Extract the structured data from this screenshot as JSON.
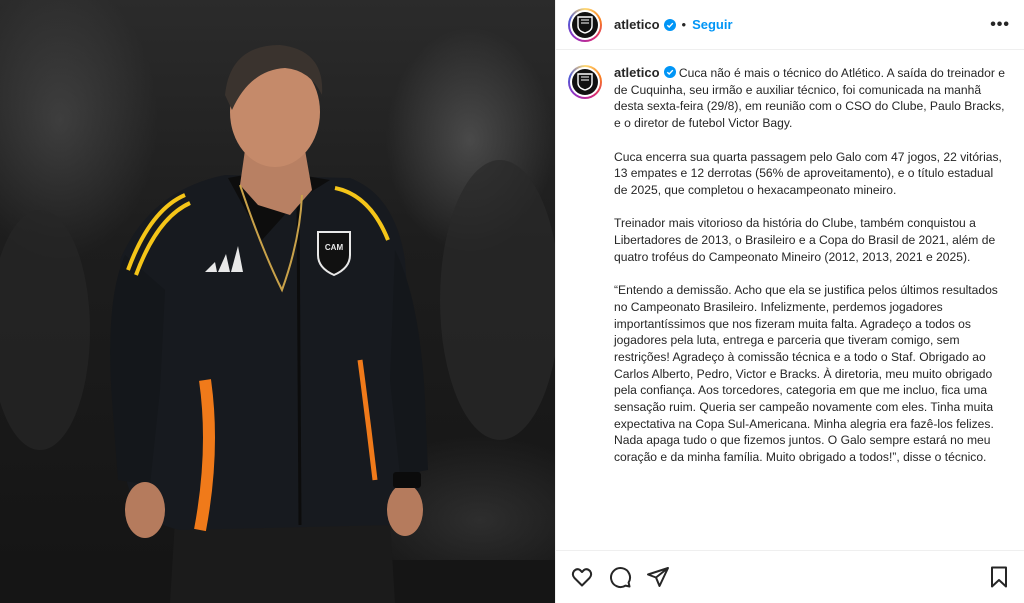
{
  "post": {
    "username": "atletico",
    "separator": "•",
    "follow_label": "Seguir",
    "more_label": "•••",
    "caption_username": "atletico",
    "paragraphs": [
      "Cuca não é mais o técnico do Atlético. A saída do treinador e de Cuquinha, seu irmão e auxiliar técnico, foi comunicada na manhã desta sexta-feira (29/8), em reunião com o CSO do Clube, Paulo Bracks, e o diretor de futebol Victor Bagy.",
      "Cuca encerra sua quarta passagem pelo Galo com 47 jogos, 22 vitórias, 13 empates e 12 derrotas (56% de aproveitamento), e o título estadual de 2025, que completou o hexacampeonato mineiro.",
      "Treinador mais vitorioso da história do Clube, também conquistou a Libertadores de 2013, o Brasileiro e a Copa do Brasil de 2021, além de quatro troféus do Campeonato Mineiro (2012, 2013, 2021 e 2025).",
      "“Entendo a demissão. Acho que ela se justifica pelos últimos resultados no Campeonato Brasileiro. Infelizmente, perdemos jogadores importantíssimos que nos fizeram muita falta. Agradeço a todos os jogadores pela luta, entrega e parceria que tiveram comigo, sem restrições! Agradeço à comissão técnica e a todo o Staf. Obrigado ao Carlos Alberto, Pedro, Victor e Bracks. À diretoria, meu muito obrigado pela confiança. Aos torcedores, categoria em que me incluo, fica uma sensação ruim. Queria ser campeão novamente com eles. Tinha muita expectativa na Copa Sul-Americana. Minha alegria era fazê-los felizes. Nada apaga tudo o que fizemos juntos. O Galo sempre estará no meu coração e da minha família. Muito obrigado a todos!”, disse o técnico."
    ]
  },
  "photo": {
    "crest_text": "CAM"
  },
  "icons": {
    "like": "heart-icon",
    "comment": "comment-icon",
    "share": "share-icon",
    "save": "bookmark-icon",
    "verified": "verified-badge-icon",
    "more": "more-options-icon"
  },
  "colors": {
    "follow": "#0095f6",
    "verified": "#0095f6",
    "jacket_stripe": "#f5c518",
    "jacket_accent": "#f07a1a"
  }
}
